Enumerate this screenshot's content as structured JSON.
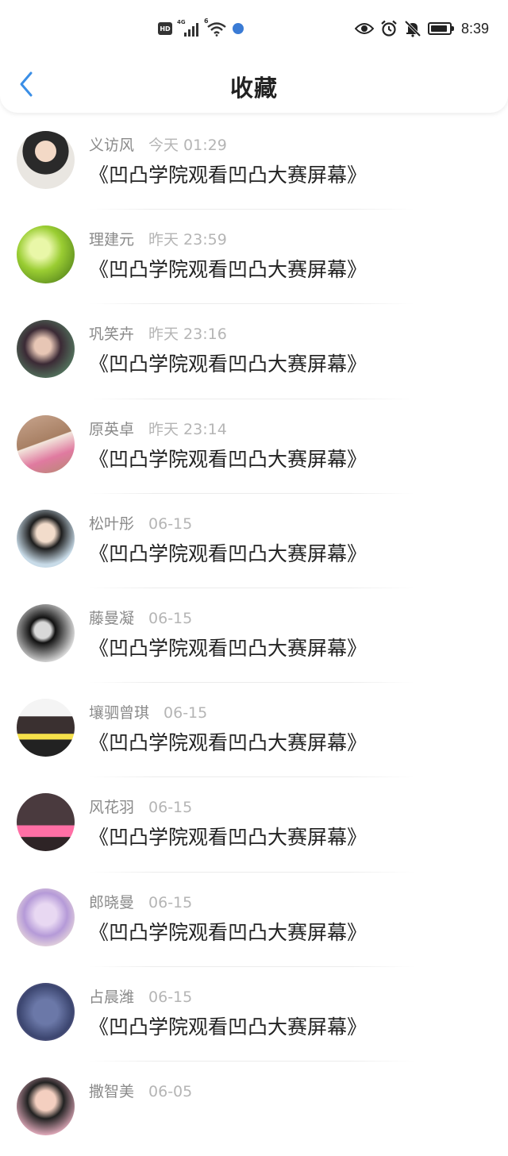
{
  "status_bar": {
    "hd": "HD",
    "network": "4G",
    "wifi_label": "6",
    "time": "8:39",
    "battery_percent": 90
  },
  "header": {
    "title": "收藏",
    "back_icon": "chevron-left-icon",
    "accent_color": "#3a8ee6"
  },
  "favorites": [
    {
      "name": "义访风",
      "time": "今天 01:29",
      "message": "《凹凸学院观看凹凸大赛屏幕》",
      "avatar": "avatar-photo"
    },
    {
      "name": "理建元",
      "time": "昨天 23:59",
      "message": "《凹凸学院观看凹凸大赛屏幕》",
      "avatar": "avatar-photo"
    },
    {
      "name": "巩笑卉",
      "time": "昨天 23:16",
      "message": "《凹凸学院观看凹凸大赛屏幕》",
      "avatar": "avatar-photo"
    },
    {
      "name": "原英卓",
      "time": "昨天 23:14",
      "message": "《凹凸学院观看凹凸大赛屏幕》",
      "avatar": "avatar-photo"
    },
    {
      "name": "松叶彤",
      "time": "06-15",
      "message": "《凹凸学院观看凹凸大赛屏幕》",
      "avatar": "avatar-photo"
    },
    {
      "name": "藤曼凝",
      "time": "06-15",
      "message": "《凹凸学院观看凹凸大赛屏幕》",
      "avatar": "avatar-photo"
    },
    {
      "name": "壤驷曾琪",
      "time": "06-15",
      "message": "《凹凸学院观看凹凸大赛屏幕》",
      "avatar": "avatar-photo"
    },
    {
      "name": "风花羽",
      "time": "06-15",
      "message": "《凹凸学院观看凹凸大赛屏幕》",
      "avatar": "avatar-photo"
    },
    {
      "name": "郎晓曼",
      "time": "06-15",
      "message": "《凹凸学院观看凹凸大赛屏幕》",
      "avatar": "avatar-photo"
    },
    {
      "name": "占晨潍",
      "time": "06-15",
      "message": "《凹凸学院观看凹凸大赛屏幕》",
      "avatar": "avatar-photo"
    },
    {
      "name": "撒智美",
      "time": "06-05",
      "message": "",
      "avatar": "avatar-photo"
    }
  ]
}
